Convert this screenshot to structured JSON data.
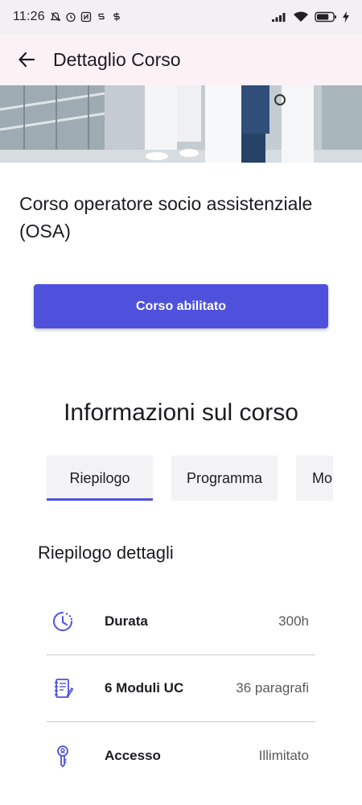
{
  "status_bar": {
    "time": "11:26",
    "battery_level": 0.75,
    "icons": [
      "mute-icon",
      "alarm-icon",
      "nfc-icon",
      "sync-icon",
      "sync-icon",
      "signal-icon",
      "wifi-icon",
      "battery-icon",
      "charging-icon"
    ]
  },
  "app_bar": {
    "title": "Dettaglio Corso",
    "back_icon": "arrow-back-icon"
  },
  "course": {
    "title": "Corso operatore socio assistenziale (OSA)",
    "button_label": "Corso abilitato"
  },
  "info": {
    "title": "Informazioni sul corso",
    "tabs": [
      {
        "label": "Riepilogo",
        "active": true
      },
      {
        "label": "Programma",
        "active": false
      },
      {
        "label": "Mo",
        "active": false
      }
    ]
  },
  "summary": {
    "title": "Riepilogo dettagli",
    "rows": [
      {
        "icon": "clock-icon",
        "label": "Durata",
        "value": "300h"
      },
      {
        "icon": "notebook-icon",
        "label": "6 Moduli UC",
        "value": "36 paragrafi"
      },
      {
        "icon": "key-icon",
        "label": "Accesso",
        "value": "Illimitato"
      }
    ]
  },
  "colors": {
    "primary": "#4f51dd",
    "app_bar_bg": "#fcf2f6",
    "status_bar_bg": "#f3f0f3",
    "tab_bg": "#f3f2f4",
    "icon_color": "#4f51dd"
  }
}
